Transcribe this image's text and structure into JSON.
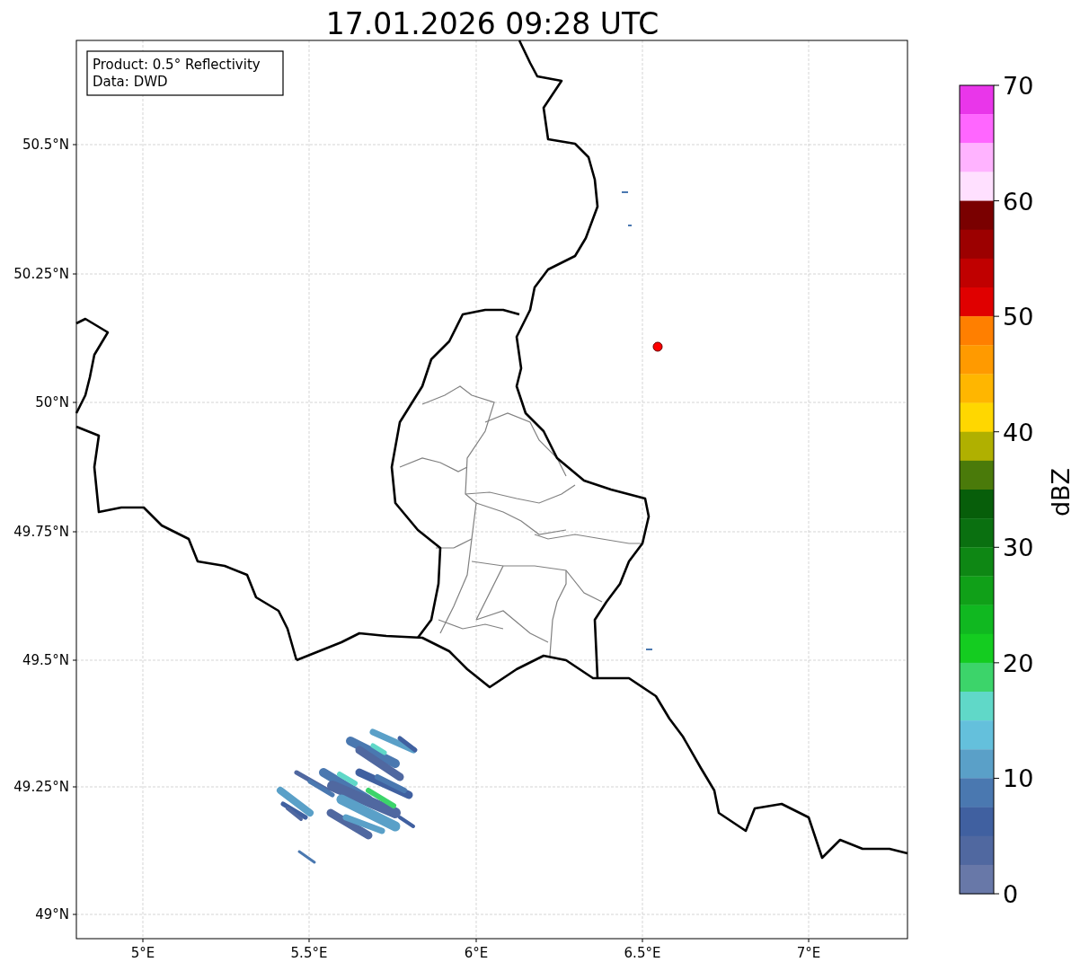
{
  "title": "17.01.2026 09:28 UTC",
  "info_box": [
    "Product: 0.5° Reflectivity",
    "Data: DWD"
  ],
  "y_ticks": [
    "50.5°N",
    "50.25°N",
    "50°N",
    "49.75°N",
    "49.5°N",
    "49.25°N",
    "49°N"
  ],
  "x_ticks": [
    "5°E",
    "5.5°E",
    "6°E",
    "6.5°E",
    "7°E"
  ],
  "colorbar": {
    "label": "dBZ",
    "ticks": [
      "70",
      "60",
      "50",
      "40",
      "30",
      "20",
      "10",
      "0"
    ],
    "bins": [
      {
        "color": "#e936ea"
      },
      {
        "color": "#ff66ff"
      },
      {
        "color": "#ffb3ff"
      },
      {
        "color": "#ffe0ff"
      },
      {
        "color": "#7a0000"
      },
      {
        "color": "#9c0000"
      },
      {
        "color": "#c00000"
      },
      {
        "color": "#e00000"
      },
      {
        "color": "#ff7f00"
      },
      {
        "color": "#ff9a00"
      },
      {
        "color": "#ffb600"
      },
      {
        "color": "#ffd700"
      },
      {
        "color": "#b0b000"
      },
      {
        "color": "#4a7a0a"
      },
      {
        "color": "#075e0a"
      },
      {
        "color": "#0a7010"
      },
      {
        "color": "#0e8714"
      },
      {
        "color": "#10a018"
      },
      {
        "color": "#10b820"
      },
      {
        "color": "#14cc20"
      },
      {
        "color": "#3cd46a"
      },
      {
        "color": "#60d8c8"
      },
      {
        "color": "#64c0dc"
      },
      {
        "color": "#5aa0c8"
      },
      {
        "color": "#4a78b0"
      },
      {
        "color": "#4060a0"
      },
      {
        "color": "#5068a0"
      },
      {
        "color": "#6878a8"
      }
    ]
  }
}
